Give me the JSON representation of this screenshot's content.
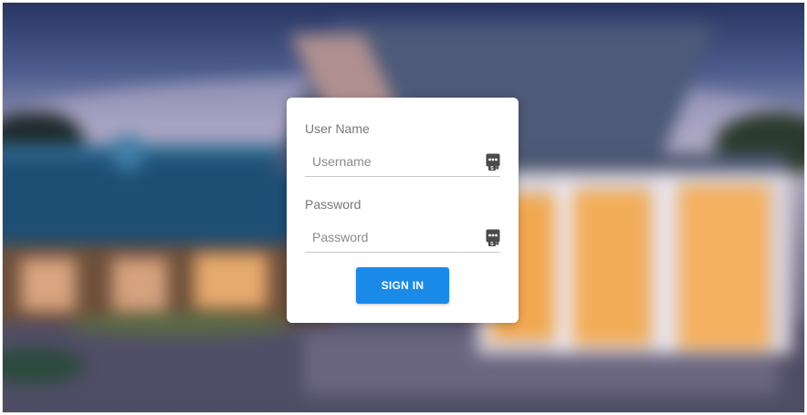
{
  "login": {
    "username_label": "User Name",
    "username_placeholder": "Username",
    "username_value": "",
    "password_label": "Password",
    "password_placeholder": "Password",
    "password_value": "",
    "submit_label": "SIGN IN"
  },
  "icons": {
    "username_field_icon": "password-manager-icon",
    "password_field_icon": "password-manager-icon"
  },
  "colors": {
    "accent": "#1a8ae8",
    "card": "#ffffff",
    "label_text": "#777777"
  }
}
